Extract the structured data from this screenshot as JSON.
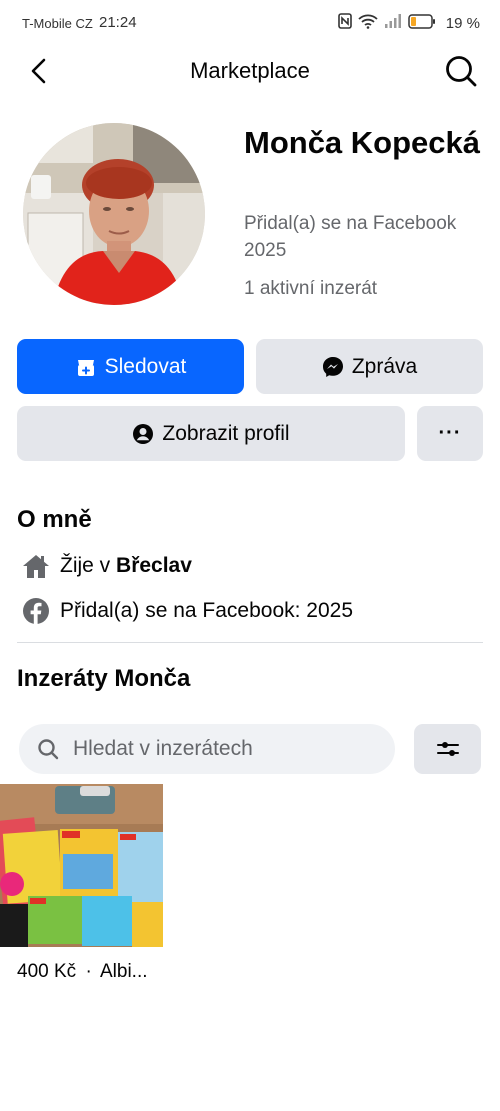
{
  "status_bar": {
    "carrier": "T-Mobile CZ",
    "time": "21:24",
    "battery_pct": "19 %"
  },
  "header": {
    "title": "Marketplace",
    "back_icon": "chevron-left-icon",
    "search_icon": "search-icon"
  },
  "profile": {
    "name": "Monča Kopecká",
    "joined": "Přidal(a) se na Facebook 2025",
    "listings_count": "1 aktivní inzerát"
  },
  "actions": {
    "follow": "Sledovat",
    "message": "Zpráva",
    "view_profile": "Zobrazit profil",
    "more": "···"
  },
  "about": {
    "title": "O mně",
    "lives_prefix": "Žije v",
    "lives_city": "Břeclav",
    "joined": "Přidal(a) se na Facebook: 2025"
  },
  "listings": {
    "title": "Inzeráty Monča",
    "search_placeholder": "Hledat v inzerátech",
    "items": [
      {
        "price": "400 Kč",
        "sep": "·",
        "title": "Albi..."
      }
    ]
  },
  "colors": {
    "accent": "#0866ff",
    "secondary_button": "#e4e6eb",
    "muted_text": "#65676b"
  }
}
